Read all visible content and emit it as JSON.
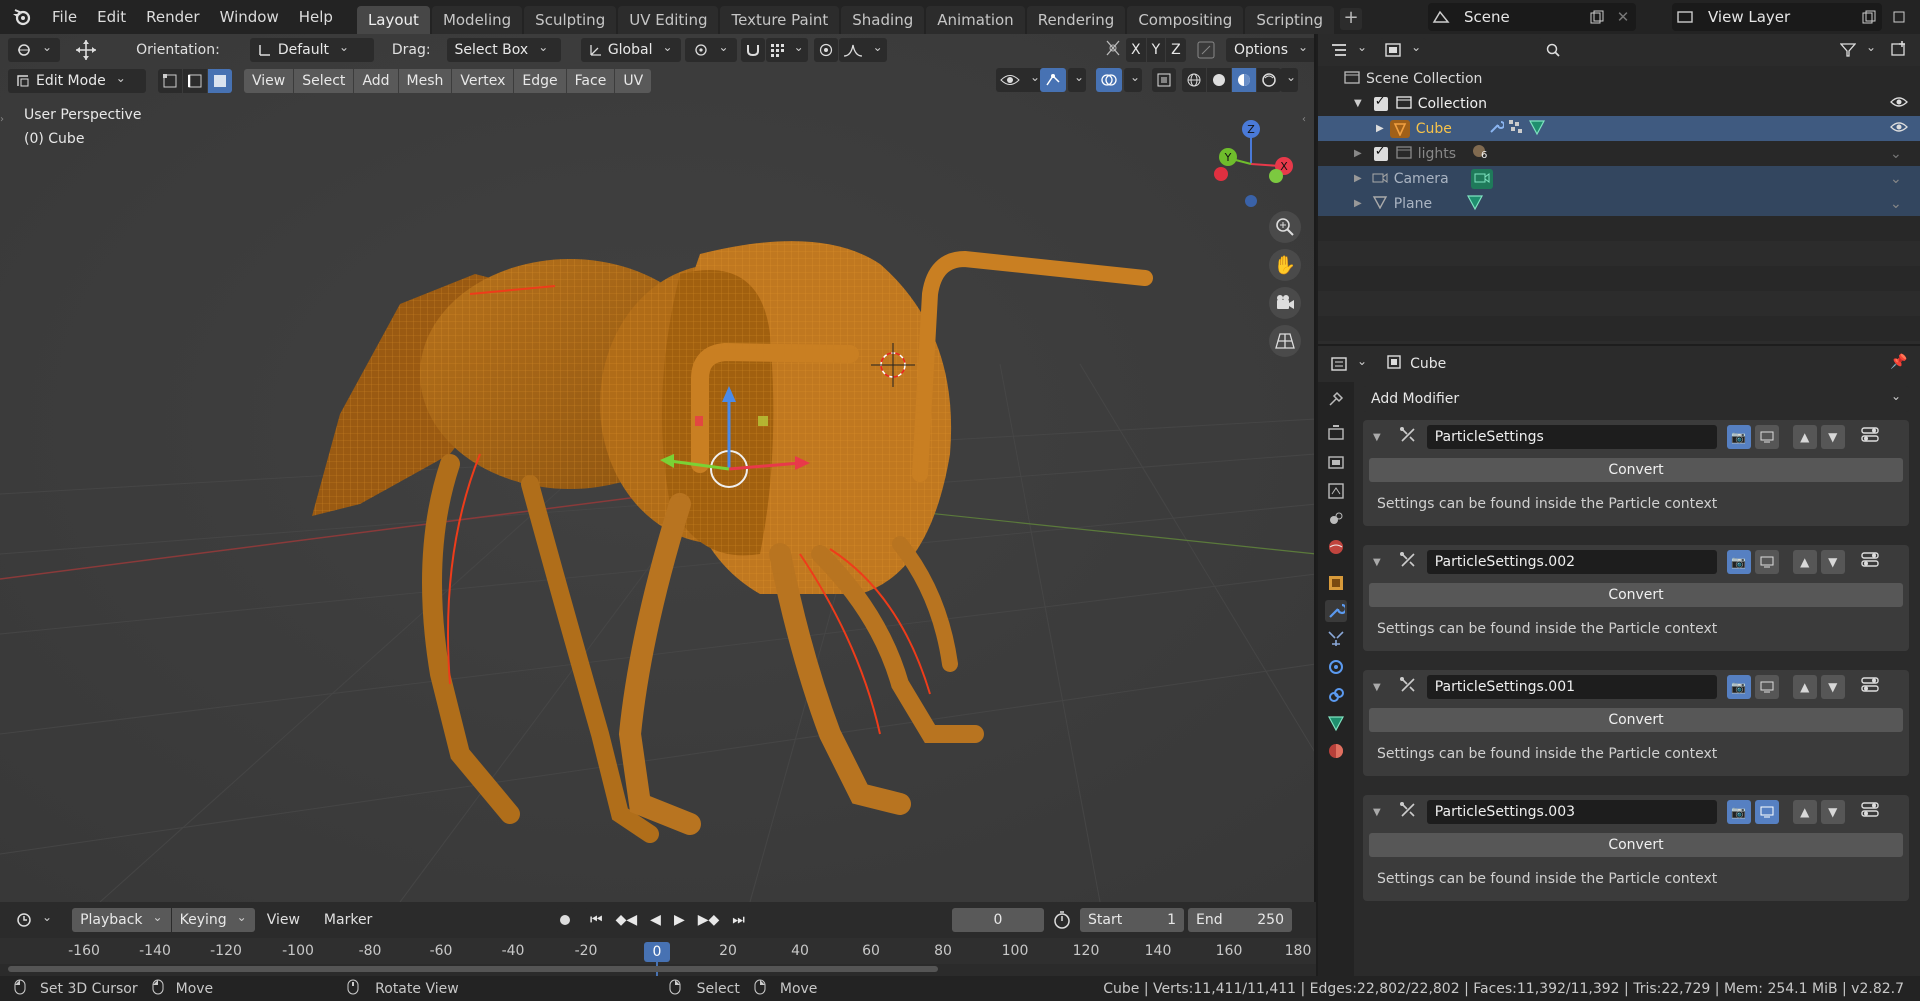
{
  "menu": [
    "File",
    "Edit",
    "Render",
    "Window",
    "Help"
  ],
  "workspaces": [
    "Layout",
    "Modeling",
    "Sculpting",
    "UV Editing",
    "Texture Paint",
    "Shading",
    "Animation",
    "Rendering",
    "Compositing",
    "Scripting"
  ],
  "active_workspace": "Layout",
  "scene": {
    "name": "Scene",
    "view_layer": "View Layer"
  },
  "tool_header": {
    "orientation_label": "Orientation:",
    "orientation_value": "Default",
    "drag_label": "Drag:",
    "drag_value": "Select Box",
    "transform_orientation": "Global",
    "axes": [
      "X",
      "Y",
      "Z"
    ],
    "options": "Options"
  },
  "view_header": {
    "mode": "Edit Mode",
    "menus": [
      "View",
      "Select",
      "Add",
      "Mesh",
      "Vertex",
      "Edge",
      "Face",
      "UV"
    ]
  },
  "viewport_overlay": {
    "line1": "User Perspective",
    "line2": "(0) Cube"
  },
  "nav_gizmo": {
    "x": "X",
    "y": "Y",
    "z": "Z"
  },
  "outliner": {
    "root": "Scene Collection",
    "items": [
      {
        "name": "Collection",
        "level": 1
      },
      {
        "name": "Cube",
        "level": 2
      },
      {
        "name": "lights",
        "level": 1,
        "badge": "6"
      },
      {
        "name": "Camera",
        "level": 1
      },
      {
        "name": "Plane",
        "level": 1
      }
    ]
  },
  "properties": {
    "object_name": "Cube",
    "add_modifier": "Add Modifier",
    "modifiers": [
      {
        "name": "ParticleSettings",
        "button": "Convert",
        "note": "Settings can be found inside the Particle context"
      },
      {
        "name": "ParticleSettings.002",
        "button": "Convert",
        "note": "Settings can be found inside the Particle context"
      },
      {
        "name": "ParticleSettings.001",
        "button": "Convert",
        "note": "Settings can be found inside the Particle context"
      },
      {
        "name": "ParticleSettings.003",
        "button": "Convert",
        "note": "Settings can be found inside the Particle context"
      }
    ]
  },
  "timeline": {
    "menus": [
      "Playback",
      "Keying",
      "View",
      "Marker"
    ],
    "current_frame": "0",
    "start_label": "Start",
    "start": "1",
    "end_label": "End",
    "end": "250",
    "ticks": [
      "-160",
      "-140",
      "-120",
      "-100",
      "-80",
      "-60",
      "-40",
      "-20",
      "0",
      "20",
      "40",
      "60",
      "80",
      "100",
      "120",
      "140",
      "160",
      "180"
    ]
  },
  "statusbar": {
    "hints": [
      "Set 3D Cursor",
      "Move",
      "Rotate View",
      "Select",
      "Move"
    ],
    "stats": "Cube | Verts:11,411/11,411 | Edges:22,802/22,802 | Faces:11,392/11,392 | Tris:22,729 | Mem: 254.1 MiB | v2.82.7"
  },
  "colors": {
    "accent": "#4772b3",
    "mesh": "#c47a1a",
    "edge_selected": "#f08a00"
  }
}
